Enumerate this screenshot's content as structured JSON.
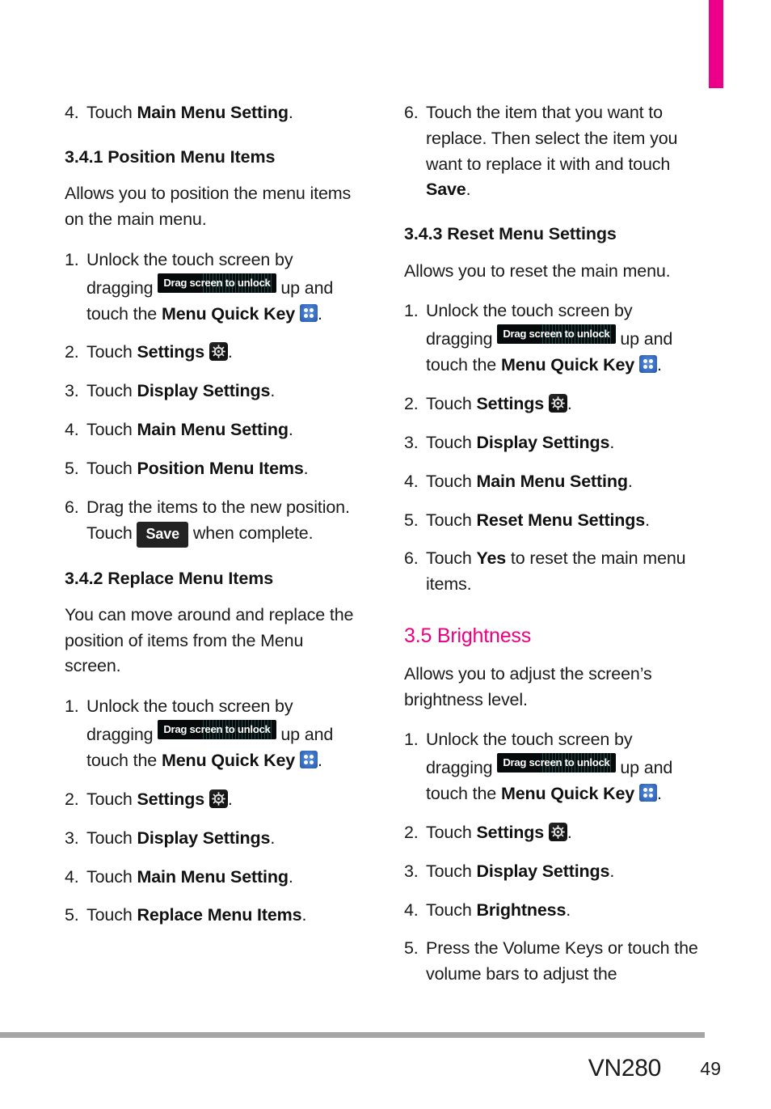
{
  "page": {
    "accent_color": "#ec0089",
    "corner_tab_color": "#ec0089",
    "rule_color": "#a5a5a5"
  },
  "icons": {
    "quick_key": "menu-quick-key-icon",
    "gear": "settings-gear-icon",
    "unlock_badge_text": "Drag screen to unlock",
    "save_badge_text": "Save"
  },
  "left_column": {
    "lead_step": {
      "num": "4.",
      "pre": "Touch ",
      "bold": "Main Menu Setting",
      "post": "."
    },
    "section_341": {
      "heading": "3.4.1 Position Menu Items",
      "intro": "Allows you to position the menu items on the main menu.",
      "steps": [
        {
          "num": "1.",
          "p1": "Unlock the touch screen by dragging ",
          "badge": "Drag screen to unlock",
          "p2": " up and touch the ",
          "bold": "Menu Quick Key",
          "p3": " ",
          "icon": "quick-key",
          "p4": "."
        },
        {
          "num": "2.",
          "p1": "Touch ",
          "bold": "Settings",
          "p2": " ",
          "icon": "gear",
          "p3": "."
        },
        {
          "num": "3.",
          "p1": "Touch ",
          "bold": "Display Settings",
          "p2": "."
        },
        {
          "num": "4.",
          "p1": "Touch ",
          "bold": "Main Menu Setting",
          "p2": "."
        },
        {
          "num": "5.",
          "p1": "Touch ",
          "bold": "Position Menu Items",
          "p2": "."
        },
        {
          "num": "6.",
          "p1": "Drag the items to the new position. Touch ",
          "badge": "Save",
          "p2": " when complete."
        }
      ]
    },
    "section_342": {
      "heading": "3.4.2 Replace Menu Items",
      "intro": "You can move around and replace the position of items from the Menu screen.",
      "steps": [
        {
          "num": "1.",
          "p1": "Unlock the touch screen by dragging ",
          "badge": "Drag screen to unlock",
          "p2": " up and touch the ",
          "bold": "Menu Quick Key",
          "p3": " ",
          "icon": "quick-key",
          "p4": "."
        },
        {
          "num": "2.",
          "p1": "Touch ",
          "bold": "Settings",
          "p2": " ",
          "icon": "gear",
          "p3": "."
        },
        {
          "num": "3.",
          "p1": "Touch ",
          "bold": "Display Settings",
          "p2": "."
        },
        {
          "num": "4.",
          "p1": "Touch ",
          "bold": "Main Menu Setting",
          "p2": "."
        },
        {
          "num": "5.",
          "p1": "Touch ",
          "bold": "Replace Menu Items",
          "p2": "."
        }
      ]
    }
  },
  "right_column": {
    "lead_step": {
      "num": "6.",
      "p1": "Touch the item that you want to replace. Then select the item you want to replace it with and touch ",
      "bold": "Save",
      "p2": "."
    },
    "section_343": {
      "heading": "3.4.3 Reset Menu Settings",
      "intro": "Allows you to reset the main menu.",
      "steps": [
        {
          "num": "1.",
          "p1": "Unlock the touch screen by dragging ",
          "badge": "Drag screen to unlock",
          "p2": " up and touch the ",
          "bold": "Menu Quick Key",
          "p3": " ",
          "icon": "quick-key",
          "p4": "."
        },
        {
          "num": "2.",
          "p1": "Touch ",
          "bold": "Settings",
          "p2": " ",
          "icon": "gear",
          "p3": "."
        },
        {
          "num": "3.",
          "p1": "Touch ",
          "bold": "Display Settings",
          "p2": "."
        },
        {
          "num": "4.",
          "p1": "Touch ",
          "bold": "Main Menu Setting",
          "p2": "."
        },
        {
          "num": "5.",
          "p1": "Touch ",
          "bold": "Reset Menu Settings",
          "p2": "."
        },
        {
          "num": "6.",
          "p1": "Touch ",
          "bold": "Yes",
          "p2": " to reset the main menu items."
        }
      ]
    },
    "section_35": {
      "heading": "3.5 Brightness",
      "intro": "Allows you to adjust the screen’s brightness level.",
      "steps": [
        {
          "num": "1.",
          "p1": "Unlock the touch screen by dragging ",
          "badge": "Drag screen to unlock",
          "p2": " up and touch the ",
          "bold": "Menu Quick Key",
          "p3": " ",
          "icon": "quick-key",
          "p4": "."
        },
        {
          "num": "2.",
          "p1": "Touch ",
          "bold": "Settings",
          "p2": " ",
          "icon": "gear",
          "p3": "."
        },
        {
          "num": "3.",
          "p1": "Touch ",
          "bold": "Display Settings",
          "p2": "."
        },
        {
          "num": "4.",
          "p1": "Touch ",
          "bold": "Brightness",
          "p2": "."
        },
        {
          "num": "5.",
          "p1": "Press the Volume Keys or touch the volume bars to adjust the"
        }
      ]
    }
  },
  "footer": {
    "model": "VN280",
    "page_number": "49"
  }
}
